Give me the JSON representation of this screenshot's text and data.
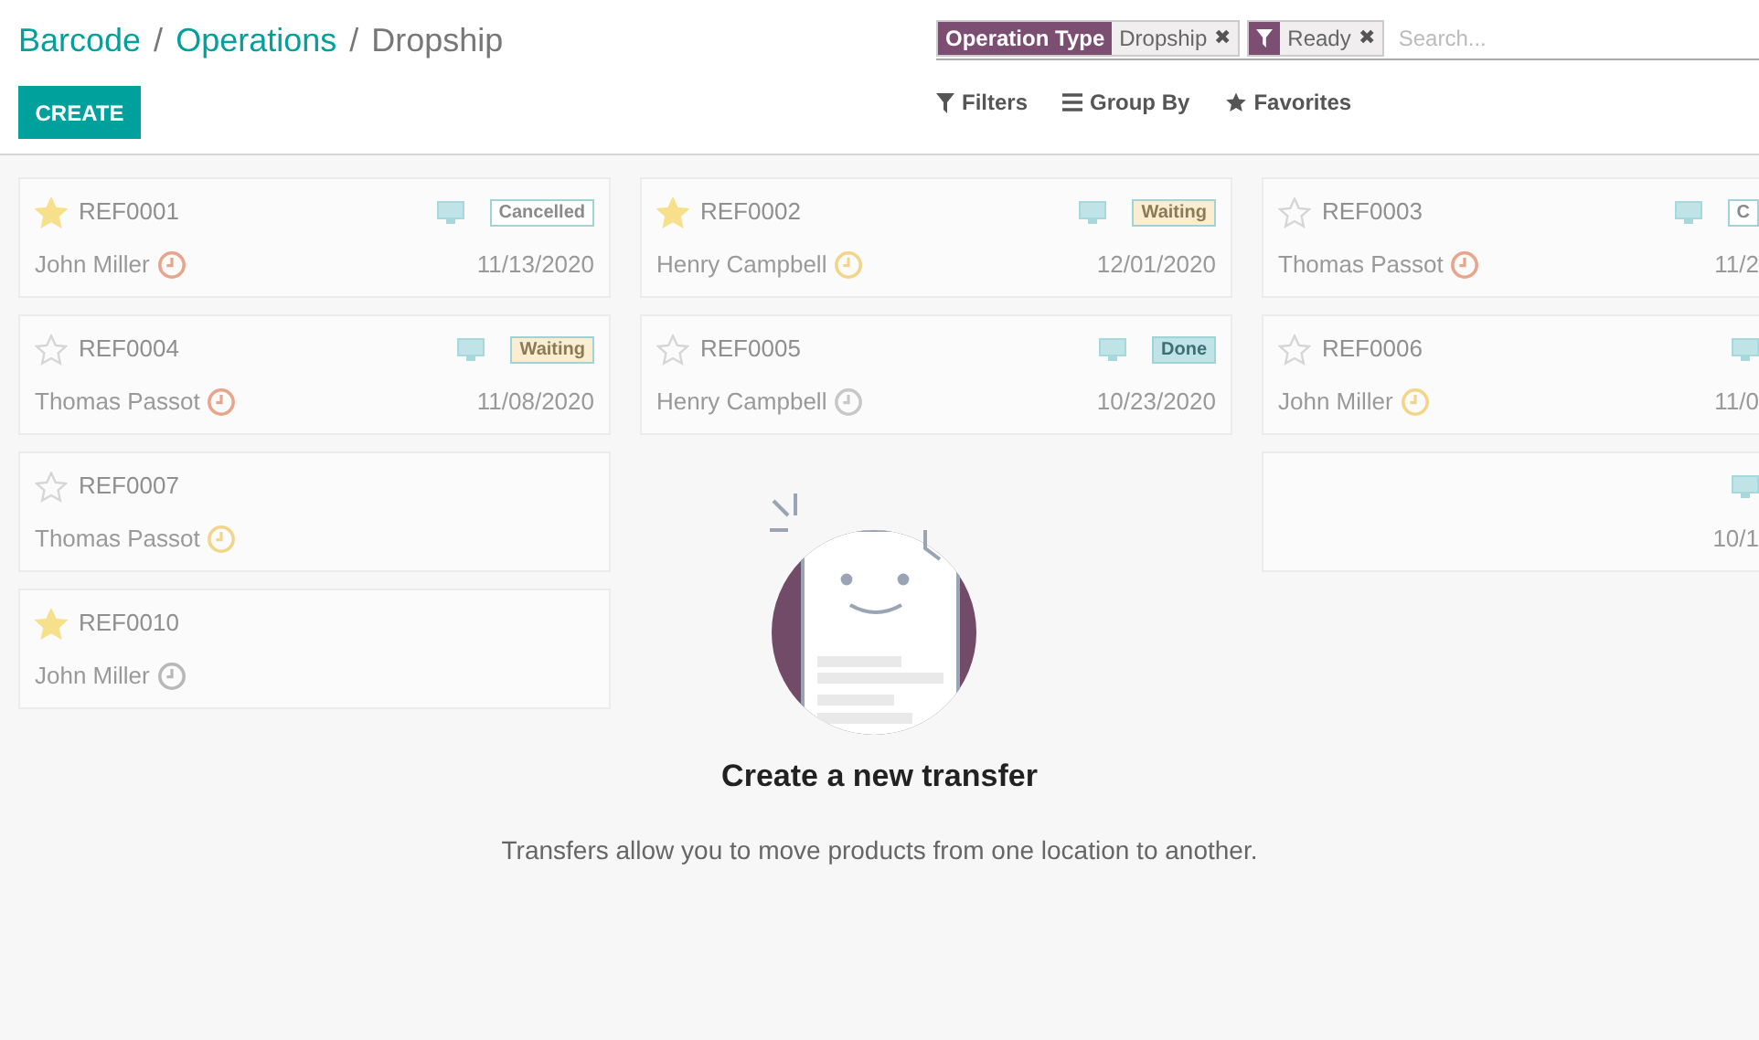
{
  "breadcrumb": [
    {
      "label": "Barcode",
      "kind": "link"
    },
    {
      "label": "/",
      "kind": "separator"
    },
    {
      "label": "Operations",
      "kind": "link"
    },
    {
      "label": "/",
      "kind": "separator"
    },
    {
      "label": "Dropship",
      "kind": "current"
    }
  ],
  "create_button": "CREATE",
  "search": {
    "facets": [
      {
        "kind": "field",
        "label": "Operation Type",
        "value": "Dropship",
        "remove": "✖"
      },
      {
        "kind": "filter",
        "value": "Ready",
        "remove": "✖"
      }
    ],
    "placeholder": "Search..."
  },
  "search_options": [
    {
      "kind": "filter",
      "label": "Filters"
    },
    {
      "kind": "group",
      "label": "Group By"
    },
    {
      "kind": "favorite",
      "label": "Favorites"
    }
  ],
  "columns": [
    [
      {
        "ref": "REF0001",
        "starred": true,
        "device": true,
        "status": {
          "label": "Cancelled",
          "kind": "outline"
        },
        "name": "John Miller",
        "color": "#e9a48c",
        "date": "11/13/2020"
      },
      {
        "ref": "REF0004",
        "starred": false,
        "device": true,
        "status": {
          "label": "Waiting",
          "kind": "warning"
        },
        "name": "Thomas Passot",
        "color": "#e9a48c",
        "date": "11/08/2020"
      },
      {
        "ref": "REF0007",
        "starred": false,
        "device": false,
        "name": "Thomas Passot",
        "color": "#f3d58a"
      },
      {
        "ref": "REF0010",
        "starred": true,
        "device": false,
        "name": "John Miller",
        "color": "#b8b8b8"
      }
    ],
    [
      {
        "ref": "REF0002",
        "starred": true,
        "device": true,
        "status": {
          "label": "Waiting",
          "kind": "warning"
        },
        "name": "Henry Campbell",
        "color": "#f3d58a",
        "date": "12/01/2020"
      },
      {
        "ref": "REF0005",
        "starred": false,
        "device": true,
        "status": {
          "label": "Done",
          "kind": "filled"
        },
        "name": "Henry Campbell",
        "color": "#c8c8c8",
        "date": "10/23/2020"
      }
    ],
    [
      {
        "ref": "REF0003",
        "starred": false,
        "device": true,
        "status": {
          "label": "C",
          "kind": "outline"
        },
        "name": "Thomas Passot",
        "color": "#e9a48c",
        "date": "11/2"
      },
      {
        "ref": "REF0006",
        "starred": false,
        "device": true,
        "name": "John Miller",
        "color": "#f3d58a",
        "date": "11/0"
      },
      {
        "device": true,
        "date": "10/1"
      }
    ]
  ],
  "empty_state": {
    "title": "Create a new transfer",
    "text": "Transfers allow you to move products from one location to another."
  }
}
